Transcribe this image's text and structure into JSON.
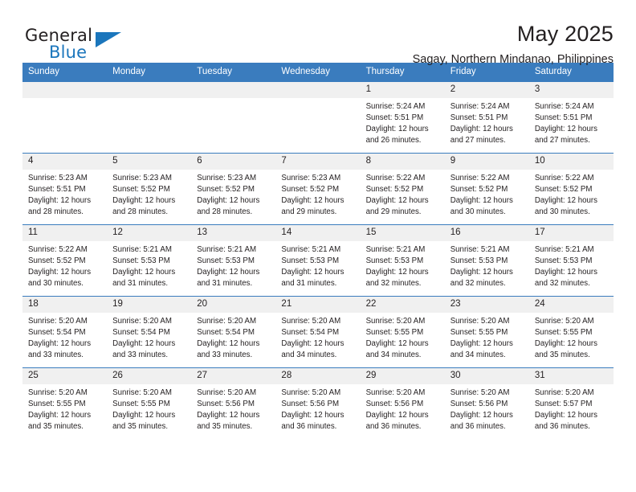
{
  "brand": {
    "name_top": "General",
    "name_bottom": "Blue",
    "accent_color": "#1b76bc"
  },
  "header": {
    "title": "May 2025",
    "subtitle": "Sagay, Northern Mindanao, Philippines"
  },
  "calendar": {
    "header_color": "#3a7cbe",
    "daynum_band_color": "#f0f0f0",
    "weekday_headers": [
      "Sunday",
      "Monday",
      "Tuesday",
      "Wednesday",
      "Thursday",
      "Friday",
      "Saturday"
    ],
    "weeks": [
      [
        {
          "day": "",
          "sunrise": "",
          "sunset": "",
          "daylight_line1": "",
          "daylight_line2": ""
        },
        {
          "day": "",
          "sunrise": "",
          "sunset": "",
          "daylight_line1": "",
          "daylight_line2": ""
        },
        {
          "day": "",
          "sunrise": "",
          "sunset": "",
          "daylight_line1": "",
          "daylight_line2": ""
        },
        {
          "day": "",
          "sunrise": "",
          "sunset": "",
          "daylight_line1": "",
          "daylight_line2": ""
        },
        {
          "day": "1",
          "sunrise": "Sunrise: 5:24 AM",
          "sunset": "Sunset: 5:51 PM",
          "daylight_line1": "Daylight: 12 hours",
          "daylight_line2": "and 26 minutes."
        },
        {
          "day": "2",
          "sunrise": "Sunrise: 5:24 AM",
          "sunset": "Sunset: 5:51 PM",
          "daylight_line1": "Daylight: 12 hours",
          "daylight_line2": "and 27 minutes."
        },
        {
          "day": "3",
          "sunrise": "Sunrise: 5:24 AM",
          "sunset": "Sunset: 5:51 PM",
          "daylight_line1": "Daylight: 12 hours",
          "daylight_line2": "and 27 minutes."
        }
      ],
      [
        {
          "day": "4",
          "sunrise": "Sunrise: 5:23 AM",
          "sunset": "Sunset: 5:51 PM",
          "daylight_line1": "Daylight: 12 hours",
          "daylight_line2": "and 28 minutes."
        },
        {
          "day": "5",
          "sunrise": "Sunrise: 5:23 AM",
          "sunset": "Sunset: 5:52 PM",
          "daylight_line1": "Daylight: 12 hours",
          "daylight_line2": "and 28 minutes."
        },
        {
          "day": "6",
          "sunrise": "Sunrise: 5:23 AM",
          "sunset": "Sunset: 5:52 PM",
          "daylight_line1": "Daylight: 12 hours",
          "daylight_line2": "and 28 minutes."
        },
        {
          "day": "7",
          "sunrise": "Sunrise: 5:23 AM",
          "sunset": "Sunset: 5:52 PM",
          "daylight_line1": "Daylight: 12 hours",
          "daylight_line2": "and 29 minutes."
        },
        {
          "day": "8",
          "sunrise": "Sunrise: 5:22 AM",
          "sunset": "Sunset: 5:52 PM",
          "daylight_line1": "Daylight: 12 hours",
          "daylight_line2": "and 29 minutes."
        },
        {
          "day": "9",
          "sunrise": "Sunrise: 5:22 AM",
          "sunset": "Sunset: 5:52 PM",
          "daylight_line1": "Daylight: 12 hours",
          "daylight_line2": "and 30 minutes."
        },
        {
          "day": "10",
          "sunrise": "Sunrise: 5:22 AM",
          "sunset": "Sunset: 5:52 PM",
          "daylight_line1": "Daylight: 12 hours",
          "daylight_line2": "and 30 minutes."
        }
      ],
      [
        {
          "day": "11",
          "sunrise": "Sunrise: 5:22 AM",
          "sunset": "Sunset: 5:52 PM",
          "daylight_line1": "Daylight: 12 hours",
          "daylight_line2": "and 30 minutes."
        },
        {
          "day": "12",
          "sunrise": "Sunrise: 5:21 AM",
          "sunset": "Sunset: 5:53 PM",
          "daylight_line1": "Daylight: 12 hours",
          "daylight_line2": "and 31 minutes."
        },
        {
          "day": "13",
          "sunrise": "Sunrise: 5:21 AM",
          "sunset": "Sunset: 5:53 PM",
          "daylight_line1": "Daylight: 12 hours",
          "daylight_line2": "and 31 minutes."
        },
        {
          "day": "14",
          "sunrise": "Sunrise: 5:21 AM",
          "sunset": "Sunset: 5:53 PM",
          "daylight_line1": "Daylight: 12 hours",
          "daylight_line2": "and 31 minutes."
        },
        {
          "day": "15",
          "sunrise": "Sunrise: 5:21 AM",
          "sunset": "Sunset: 5:53 PM",
          "daylight_line1": "Daylight: 12 hours",
          "daylight_line2": "and 32 minutes."
        },
        {
          "day": "16",
          "sunrise": "Sunrise: 5:21 AM",
          "sunset": "Sunset: 5:53 PM",
          "daylight_line1": "Daylight: 12 hours",
          "daylight_line2": "and 32 minutes."
        },
        {
          "day": "17",
          "sunrise": "Sunrise: 5:21 AM",
          "sunset": "Sunset: 5:53 PM",
          "daylight_line1": "Daylight: 12 hours",
          "daylight_line2": "and 32 minutes."
        }
      ],
      [
        {
          "day": "18",
          "sunrise": "Sunrise: 5:20 AM",
          "sunset": "Sunset: 5:54 PM",
          "daylight_line1": "Daylight: 12 hours",
          "daylight_line2": "and 33 minutes."
        },
        {
          "day": "19",
          "sunrise": "Sunrise: 5:20 AM",
          "sunset": "Sunset: 5:54 PM",
          "daylight_line1": "Daylight: 12 hours",
          "daylight_line2": "and 33 minutes."
        },
        {
          "day": "20",
          "sunrise": "Sunrise: 5:20 AM",
          "sunset": "Sunset: 5:54 PM",
          "daylight_line1": "Daylight: 12 hours",
          "daylight_line2": "and 33 minutes."
        },
        {
          "day": "21",
          "sunrise": "Sunrise: 5:20 AM",
          "sunset": "Sunset: 5:54 PM",
          "daylight_line1": "Daylight: 12 hours",
          "daylight_line2": "and 34 minutes."
        },
        {
          "day": "22",
          "sunrise": "Sunrise: 5:20 AM",
          "sunset": "Sunset: 5:55 PM",
          "daylight_line1": "Daylight: 12 hours",
          "daylight_line2": "and 34 minutes."
        },
        {
          "day": "23",
          "sunrise": "Sunrise: 5:20 AM",
          "sunset": "Sunset: 5:55 PM",
          "daylight_line1": "Daylight: 12 hours",
          "daylight_line2": "and 34 minutes."
        },
        {
          "day": "24",
          "sunrise": "Sunrise: 5:20 AM",
          "sunset": "Sunset: 5:55 PM",
          "daylight_line1": "Daylight: 12 hours",
          "daylight_line2": "and 35 minutes."
        }
      ],
      [
        {
          "day": "25",
          "sunrise": "Sunrise: 5:20 AM",
          "sunset": "Sunset: 5:55 PM",
          "daylight_line1": "Daylight: 12 hours",
          "daylight_line2": "and 35 minutes."
        },
        {
          "day": "26",
          "sunrise": "Sunrise: 5:20 AM",
          "sunset": "Sunset: 5:55 PM",
          "daylight_line1": "Daylight: 12 hours",
          "daylight_line2": "and 35 minutes."
        },
        {
          "day": "27",
          "sunrise": "Sunrise: 5:20 AM",
          "sunset": "Sunset: 5:56 PM",
          "daylight_line1": "Daylight: 12 hours",
          "daylight_line2": "and 35 minutes."
        },
        {
          "day": "28",
          "sunrise": "Sunrise: 5:20 AM",
          "sunset": "Sunset: 5:56 PM",
          "daylight_line1": "Daylight: 12 hours",
          "daylight_line2": "and 36 minutes."
        },
        {
          "day": "29",
          "sunrise": "Sunrise: 5:20 AM",
          "sunset": "Sunset: 5:56 PM",
          "daylight_line1": "Daylight: 12 hours",
          "daylight_line2": "and 36 minutes."
        },
        {
          "day": "30",
          "sunrise": "Sunrise: 5:20 AM",
          "sunset": "Sunset: 5:56 PM",
          "daylight_line1": "Daylight: 12 hours",
          "daylight_line2": "and 36 minutes."
        },
        {
          "day": "31",
          "sunrise": "Sunrise: 5:20 AM",
          "sunset": "Sunset: 5:57 PM",
          "daylight_line1": "Daylight: 12 hours",
          "daylight_line2": "and 36 minutes."
        }
      ]
    ]
  }
}
